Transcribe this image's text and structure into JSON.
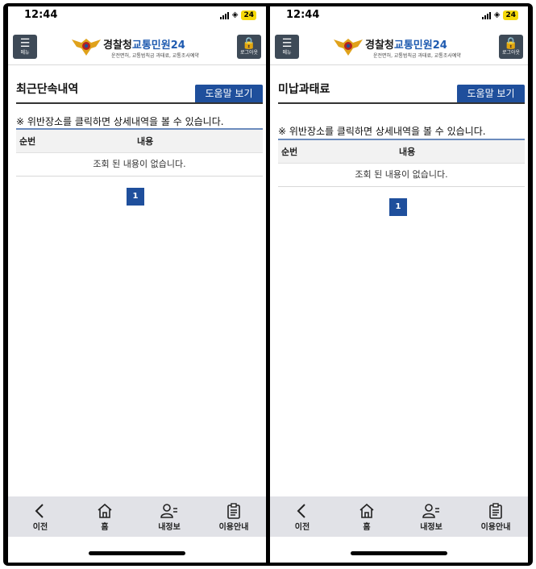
{
  "status_bar": {
    "time": "12:44",
    "battery": "24"
  },
  "header": {
    "menu_label": "메뉴",
    "brand_main": "경찰청",
    "brand_sub": "교통민원24",
    "brand_caption": "운전면허, 교통범칙금 과태료, 교통조사예약",
    "logout_label": "로그아웃"
  },
  "left_page": {
    "title": "최근단속내역",
    "help_label": "도움말 보기",
    "notice": "※ 위반장소를 클릭하면 상세내역을 볼 수 있습니다.",
    "columns": [
      "순번",
      "내용"
    ],
    "empty_message": "조회 된 내용이 없습니다.",
    "page": "1"
  },
  "right_page": {
    "title": "미납과태료",
    "help_label": "도움말 보기",
    "notice": "※ 위반장소를 클릭하면 상세내역을 볼 수 있습니다.",
    "columns": [
      "순번",
      "내용"
    ],
    "empty_message": "조회 된 내용이 없습니다.",
    "page": "1"
  },
  "bottom_nav": {
    "items": [
      {
        "label": "이전",
        "icon": "back-arrow-icon"
      },
      {
        "label": "홈",
        "icon": "home-icon"
      },
      {
        "label": "내정보",
        "icon": "user-info-icon"
      },
      {
        "label": "이용안내",
        "icon": "clipboard-icon"
      }
    ]
  },
  "colors": {
    "accent": "#1f4f9c",
    "header_button": "#3e4a57",
    "nav_background": "#e1e2e7"
  }
}
